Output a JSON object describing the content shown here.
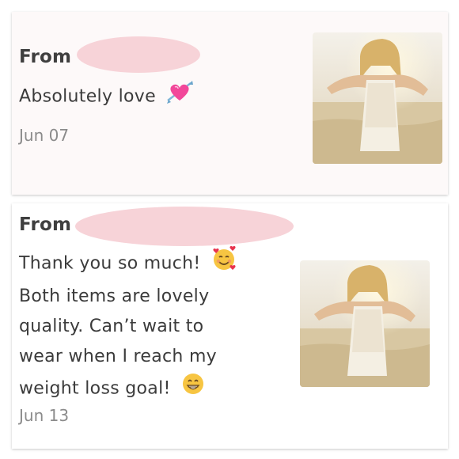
{
  "messages": [
    {
      "from_label": "From",
      "text": "Absolutely love",
      "emoji": "heart-with-arrow-icon",
      "date": "Jun 07",
      "photo": "product-photo"
    },
    {
      "from_label": "From",
      "lines": [
        "Thank you so much!",
        "Both items are lovely",
        "quality. Can’t wait to",
        "wear when I reach my",
        "weight loss goal!"
      ],
      "emojis": [
        "smiling-face-with-hearts-icon",
        "grinning-face-icon"
      ],
      "date": "Jun 13",
      "photo": "product-photo"
    }
  ],
  "colors": {
    "redaction": "#f7d3d8",
    "text": "#3b3b3b",
    "date": "#8b8b8b",
    "card_bg": "#fdf9f9"
  }
}
